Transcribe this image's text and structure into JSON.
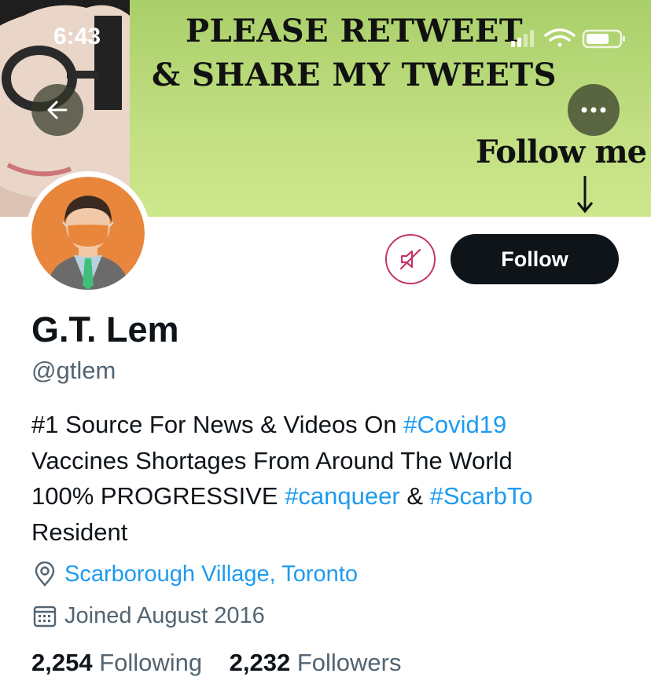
{
  "status_bar": {
    "time": "6:43"
  },
  "banner": {
    "line1": "PLEASE RETWEET",
    "line2": "& SHARE MY TWEETS",
    "follow_me": "Follow me"
  },
  "profile": {
    "name": "G.T. Lem",
    "handle": "@gtlem",
    "bio": [
      [
        {
          "text": "#1 Source For News & Videos On ",
          "tag": false
        },
        {
          "text": "#Covid19",
          "tag": true
        }
      ],
      [
        {
          "text": "Vaccines Shortages From Around The World",
          "tag": false
        }
      ],
      [
        {
          "text": "100% PROGRESSIVE ",
          "tag": false
        },
        {
          "text": "#canqueer",
          "tag": true
        },
        {
          "text": " & ",
          "tag": false
        },
        {
          "text": "#ScarbTo",
          "tag": true
        }
      ],
      [
        {
          "text": "Resident",
          "tag": false
        }
      ]
    ],
    "location": "Scarborough Village, Toronto",
    "joined": "Joined August 2016",
    "following_count": "2,254",
    "following_label": "Following",
    "followers_count": "2,232",
    "followers_label": "Followers"
  },
  "actions": {
    "follow_label": "Follow"
  },
  "icons": {
    "back": "arrow-left-icon",
    "more": "more-horizontal-icon",
    "notifications": "bell-muted-icon",
    "location": "location-pin-icon",
    "calendar": "calendar-icon"
  },
  "colors": {
    "accent": "#1d9bf0",
    "text": "#0f1419",
    "secondary": "#536471",
    "notif_ring": "#c4346b",
    "banner": "#c2df82"
  }
}
